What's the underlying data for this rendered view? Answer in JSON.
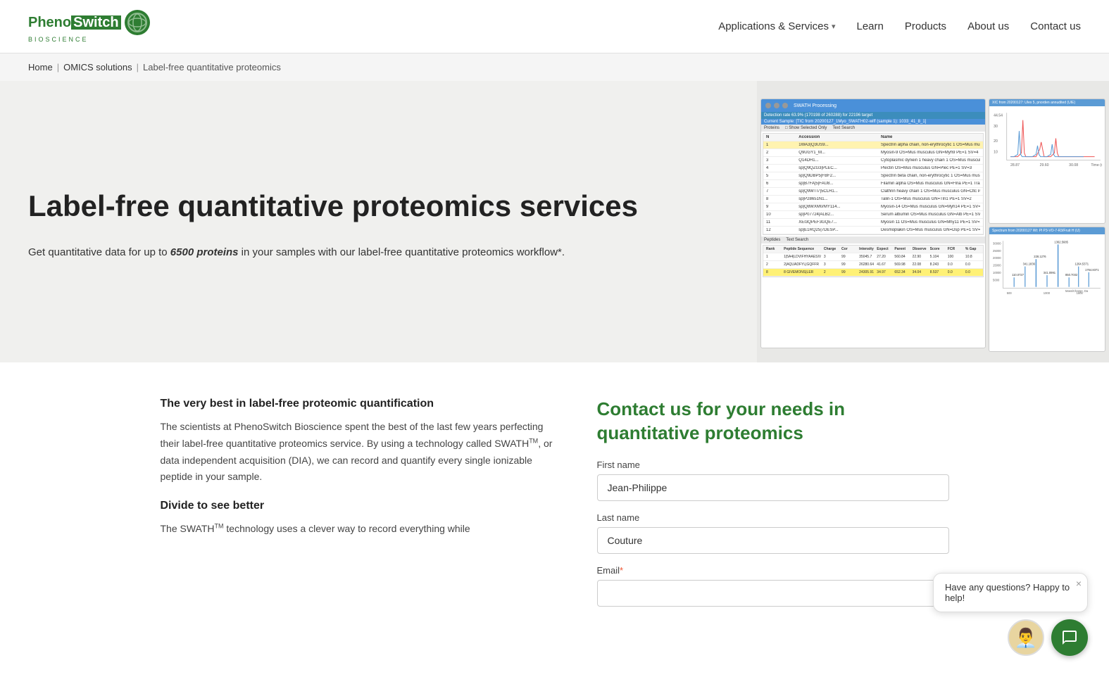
{
  "brand": {
    "name_part1": "Pheno",
    "name_part2": "Switch",
    "sub": "BIOSCIENCE",
    "icon_symbol": "⚙"
  },
  "nav": {
    "items": [
      {
        "label": "Applications & Services",
        "has_dropdown": true
      },
      {
        "label": "Learn",
        "has_dropdown": false
      },
      {
        "label": "Products",
        "has_dropdown": false
      },
      {
        "label": "About us",
        "has_dropdown": false
      },
      {
        "label": "Contact us",
        "has_dropdown": false
      }
    ]
  },
  "breadcrumb": {
    "items": [
      "Home",
      "OMICS solutions",
      "Label-free quantitative proteomics"
    ]
  },
  "hero": {
    "title": "Label-free quantitative proteomics services",
    "description_start": "Get quantitative data for up to ",
    "description_bold": "6500 proteins",
    "description_end": " in your samples with our label-free quantitative proteomics workflow*."
  },
  "content": {
    "left": {
      "subtitle": "The very best in label-free proteomic quantification",
      "paragraph1": "The scientists at PhenoSwitch Bioscience spent the best of the last few years perfecting their label-free quantitative proteomics service. By using a technology called SWATH",
      "swath_sup": "TM",
      "paragraph1_cont": ", or data independent acquisition (DIA), we can record and quantify every single ionizable peptide in your sample.",
      "subtitle2": "Divide to see better",
      "paragraph2": "The SWATH",
      "swath_sup2": "TM",
      "paragraph2_cont": " technology uses a clever way to record everything while"
    },
    "right": {
      "form_title": "Contact us for your needs in quantitative proteomics",
      "fields": [
        {
          "label": "First name",
          "required": false,
          "placeholder": "",
          "value": "Jean-Philippe",
          "id": "first_name"
        },
        {
          "label": "Last name",
          "required": false,
          "placeholder": "",
          "value": "Couture",
          "id": "last_name"
        },
        {
          "label": "Email",
          "required": true,
          "placeholder": "",
          "value": "",
          "id": "email"
        }
      ]
    }
  },
  "chat": {
    "bubble_text": "Have any questions? Happy to help!",
    "close_label": "×",
    "avatar_emoji": "👨‍💼"
  }
}
